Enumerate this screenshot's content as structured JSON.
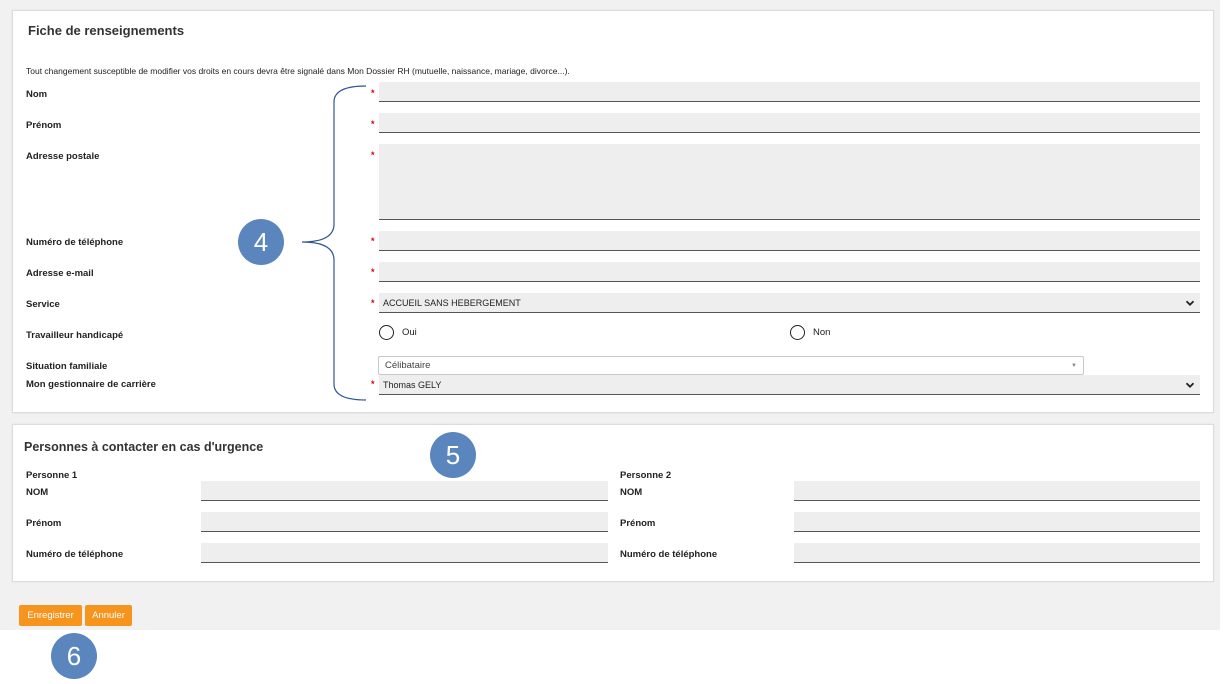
{
  "fiche": {
    "title": "Fiche de renseignements",
    "intro": "Tout changement susceptible de modifier vos droits en cours devra être signalé dans Mon Dossier RH (mutuelle, naissance, mariage, divorce...).",
    "required_mark": "*",
    "nom_label": "Nom",
    "prenom_label": "Prénom",
    "adresse_label": "Adresse postale",
    "telephone_label": "Numéro de téléphone",
    "email_label": "Adresse e-mail",
    "service_label": "Service",
    "service_value": "ACCUEIL SANS HEBERGEMENT",
    "handicape_label": "Travailleur handicapé",
    "oui_label": "Oui",
    "non_label": "Non",
    "situation_label": "Situation familiale",
    "situation_value": "Célibataire",
    "gestionnaire_label": "Mon gestionnaire de carrière",
    "gestionnaire_value": "Thomas GELY"
  },
  "urgence": {
    "title": "Personnes à contacter en cas d'urgence",
    "personne1": {
      "heading": "Personne 1",
      "nom_label": "NOM",
      "prenom_label": "Prénom",
      "telephone_label": "Numéro de téléphone"
    },
    "personne2": {
      "heading": "Personne 2",
      "nom_label": "NOM",
      "prenom_label": "Prénom",
      "telephone_label": "Numéro de téléphone"
    }
  },
  "actions": {
    "save_label": "Enregistrer",
    "cancel_label": "Annuler"
  },
  "callouts": {
    "four": "4",
    "five": "5",
    "six": "6"
  },
  "colors": {
    "accent_button": "#f7941d",
    "callout": "#5a86bd",
    "required": "#dd0000",
    "field_bg": "#eeeeee"
  },
  "icons": [
    "chevron-down-icon",
    "dropdown-triangle-icon",
    "radio-icon"
  ]
}
